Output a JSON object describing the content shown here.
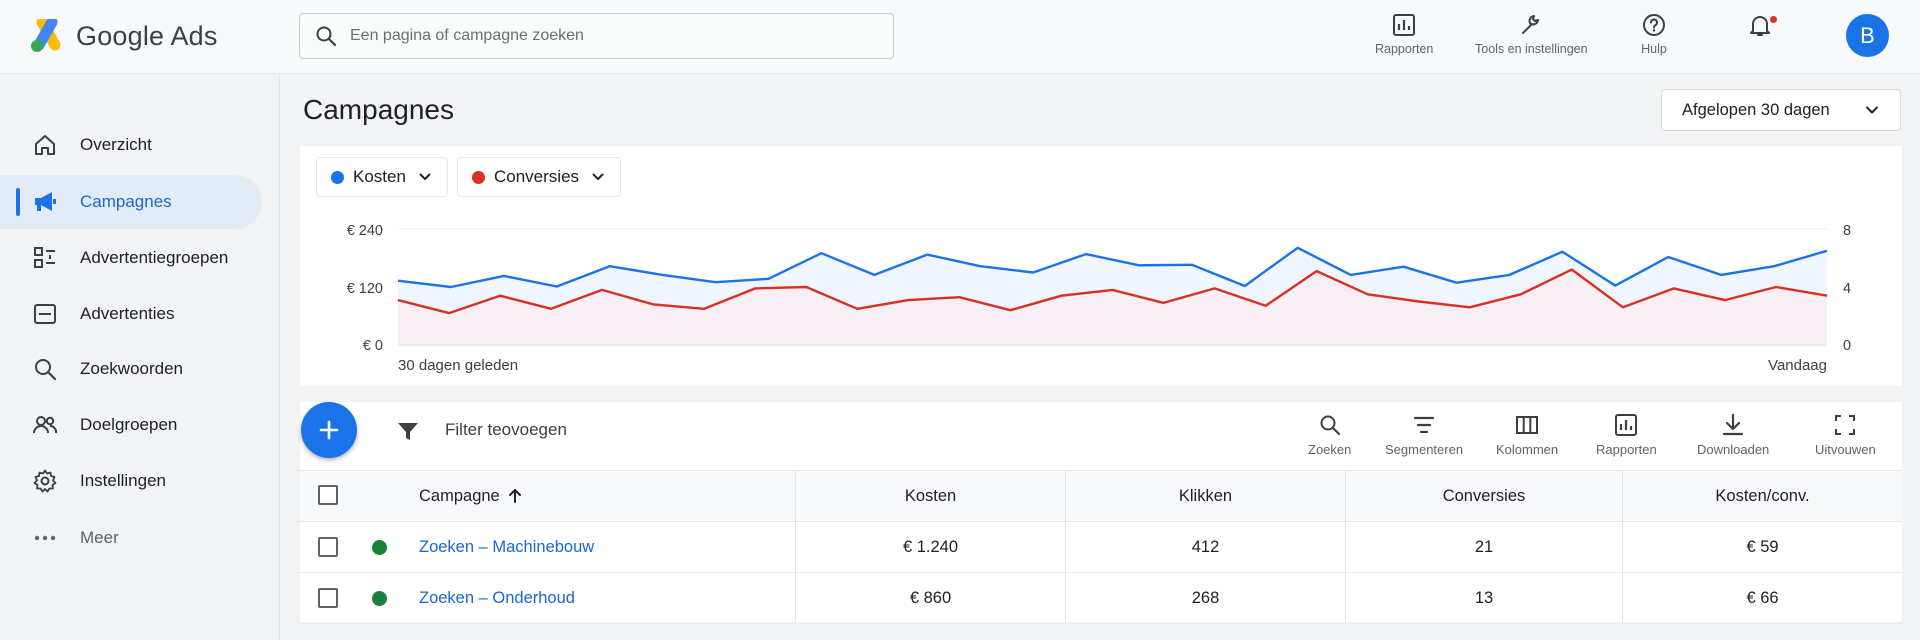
{
  "header": {
    "app_name": "Google Ads",
    "search_placeholder": "Een pagina of campagne zoeken",
    "actions": [
      {
        "label": "Rapporten",
        "icon": "reports-icon"
      },
      {
        "label": "Tools en instellingen",
        "icon": "wrench-icon"
      },
      {
        "label": "Hulp",
        "icon": "help-icon"
      },
      {
        "label": "",
        "icon": "bell-icon"
      }
    ],
    "avatar_letter": "B"
  },
  "sidebar": {
    "items": [
      {
        "label": "Overzicht",
        "icon": "home-icon"
      },
      {
        "label": "Campagnes",
        "icon": "megaphone-icon",
        "active": true
      },
      {
        "label": "Advertentiegroepen",
        "icon": "ad-groups-icon"
      },
      {
        "label": "Advertenties",
        "icon": "ads-icon"
      },
      {
        "label": "Zoekwoorden",
        "icon": "search-icon"
      },
      {
        "label": "Doelgroepen",
        "icon": "audience-icon"
      },
      {
        "label": "Instellingen",
        "icon": "gear-icon"
      },
      {
        "label": "Meer",
        "icon": "more-icon"
      }
    ]
  },
  "main": {
    "title": "Campagnes",
    "date_range": "Afgelopen 30 dagen",
    "metrics": [
      {
        "label": "Kosten",
        "color": "#1a73e8"
      },
      {
        "label": "Conversies",
        "color": "#d93025"
      }
    ],
    "toolbar": {
      "filter_label": "Filter teovoegen",
      "tools": [
        "Zoeken",
        "Segmenteren",
        "Kolommen",
        "Rapporten",
        "Downloaden",
        "Uitvouwen"
      ]
    },
    "table": {
      "columns": [
        "Campagne",
        "Kosten",
        "Klikken",
        "Conversies",
        "Kosten/conv."
      ],
      "rows": [
        {
          "name": "Zoeken – Machinebouw",
          "cost": "€ 1.240",
          "clicks": "412",
          "conversions": "21",
          "cost_per_conv": "€ 59"
        },
        {
          "name": "Zoeken – Onderhoud",
          "cost": "€ 860",
          "clicks": "268",
          "conversions": "13",
          "cost_per_conv": "€ 66"
        }
      ]
    }
  },
  "chart_data": {
    "type": "line",
    "x_start_label": "30 dagen geleden",
    "x_end_label": "Vandaag",
    "y_left": {
      "ticks": [
        "€ 0",
        "€ 120",
        "€ 240"
      ],
      "range": [
        0,
        240
      ]
    },
    "y_right": {
      "ticks": [
        "0",
        "4",
        "8"
      ],
      "range": [
        0,
        8
      ]
    },
    "grid": false,
    "series": [
      {
        "name": "Kosten",
        "axis": "left",
        "color": "#1a73e8",
        "values": [
          133,
          120,
          143,
          121,
          163,
          145,
          130,
          137,
          190,
          145,
          187,
          163,
          150,
          188,
          165,
          166,
          122,
          201,
          145,
          162,
          129,
          145,
          193,
          123,
          182,
          145,
          163,
          195
        ]
      },
      {
        "name": "Conversies",
        "axis": "right",
        "color": "#d93025",
        "values": [
          3.1,
          2.2,
          3.4,
          2.5,
          3.8,
          2.8,
          2.5,
          3.9,
          4.0,
          2.5,
          3.1,
          3.3,
          2.4,
          3.4,
          3.8,
          2.9,
          3.9,
          2.7,
          5.1,
          3.5,
          3.0,
          2.6,
          3.5,
          5.2,
          2.6,
          3.9,
          3.1,
          4.0,
          3.4
        ]
      }
    ]
  }
}
